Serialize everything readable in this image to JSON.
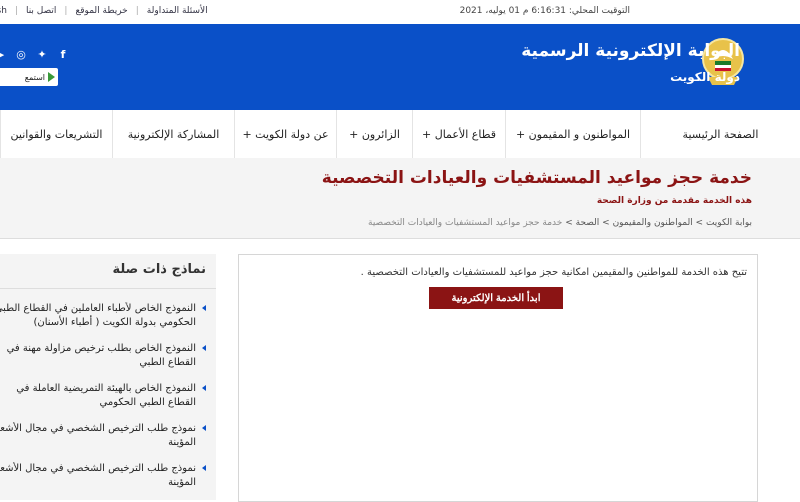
{
  "topbar": {
    "time": "التوقيت المحلي: 6:16:31 م 01 يوليه، 2021",
    "links": [
      "الأسئلة المتداولة",
      "خريطة الموقع",
      "اتصل بنا",
      "ish"
    ]
  },
  "header": {
    "title": "البوابة الإلكترونية الرسمية",
    "subtitle": "دولة الكويت",
    "listen_label": "استمع",
    "social": [
      "facebook-icon",
      "twitter-icon",
      "instagram-icon",
      "youtube-icon"
    ]
  },
  "nav": {
    "items": [
      "الصفحة الرئيسية",
      "المواطنون و المقيمون +",
      "قطاع الأعمال +",
      "الزائرون +",
      "عن دولة الكويت +",
      "المشاركة الإلكترونية",
      "التشريعات والقوانين"
    ]
  },
  "page": {
    "title": "خدمة حجز مواعيد المستشفيات والعيادات التخصصية",
    "subtitle": "هذه الخدمة مقدمة من وزارة الصحة",
    "breadcrumb": {
      "path": "بوابة الكويت > المواطنون والمقيمون > الصحة > ",
      "current": "خدمة حجز مواعيد المستشفيات والعيادات التخصصية"
    }
  },
  "service": {
    "description": "تتيح هذه الخدمة للمواطنين والمقيمين امكانية حجز مواعيد للمستشفيات والعيادات التخصصية .",
    "start_button": "ابدأ الخدمة الإلكترونية"
  },
  "related": {
    "title": "نماذج ذات صلة",
    "items": [
      [
        "النموذج الخاص لأطباء العاملين في القطاع الطبي",
        "الحكومي بدولة الكويت ( أطباء الأسنان)"
      ],
      [
        "النموذج الخاص بطلب ترخيص مزاولة مهنة في",
        "القطاع الطبي"
      ],
      [
        "النموذج الخاص بالهيئة التمريضية العاملة في",
        "القطاع الطبي الحكومي"
      ],
      [
        "نموذج طلب الترخيص الشخصي في مجال الأشعة",
        "المؤينة"
      ],
      [
        "نموذج طلب الترخيص الشخصي في مجال الأشعة",
        "المؤينة"
      ]
    ]
  }
}
